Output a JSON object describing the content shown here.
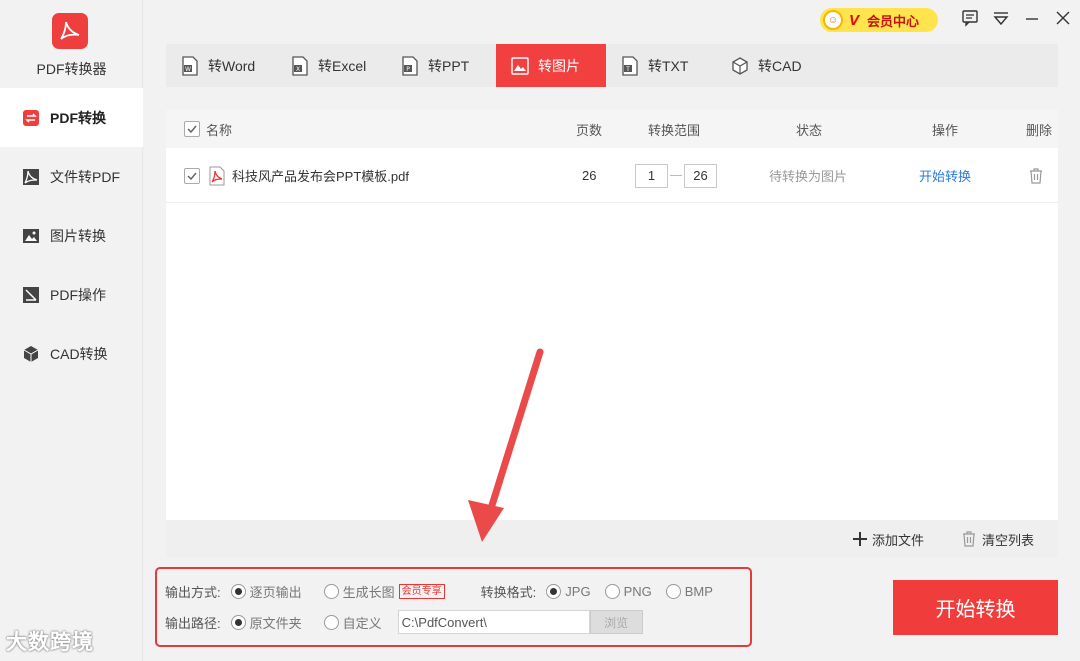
{
  "app": {
    "name": "PDF转换器"
  },
  "sidebar": {
    "items": [
      {
        "label": "PDF转换",
        "icon": "convert-icon",
        "active": true
      },
      {
        "label": "文件转PDF",
        "icon": "pdf-file-icon",
        "active": false
      },
      {
        "label": "图片转换",
        "icon": "image-icon",
        "active": false
      },
      {
        "label": "PDF操作",
        "icon": "edit-icon",
        "active": false
      },
      {
        "label": "CAD转换",
        "icon": "cube-icon",
        "active": false
      }
    ]
  },
  "header": {
    "vip_label": "会员中心"
  },
  "tabs": [
    {
      "label": "转Word"
    },
    {
      "label": "转Excel"
    },
    {
      "label": "转PPT"
    },
    {
      "label": "转图片",
      "active": true
    },
    {
      "label": "转TXT"
    },
    {
      "label": "转CAD"
    }
  ],
  "table": {
    "headers": {
      "name": "名称",
      "pages": "页数",
      "range": "转换范围",
      "status": "状态",
      "action": "操作",
      "delete": "删除"
    },
    "rows": [
      {
        "name": "科技风产品发布会PPT模板.pdf",
        "pages": "26",
        "range_from": "1",
        "range_to": "26",
        "status": "待转换为图片",
        "action": "开始转换"
      }
    ]
  },
  "footer": {
    "add_file": "添加文件",
    "clear_list": "清空列表"
  },
  "options": {
    "output_mode_label": "输出方式:",
    "output_mode_per_page": "逐页输出",
    "output_mode_long": "生成长图",
    "member_badge": "会员专享",
    "format_label": "转换格式:",
    "format_jpg": "JPG",
    "format_png": "PNG",
    "format_bmp": "BMP",
    "path_label": "输出路径:",
    "path_original": "原文件夹",
    "path_custom": "自定义",
    "path_value": "C:\\PdfConvert\\",
    "browse_label": "浏览"
  },
  "start_button": "开始转换",
  "watermark": "大数跨境",
  "colors": {
    "accent": "#f13c3c",
    "link": "#2a7bdc"
  }
}
